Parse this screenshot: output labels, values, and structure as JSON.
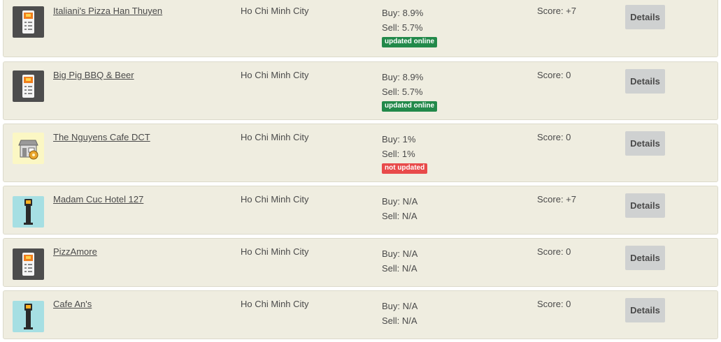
{
  "details_label": "Details",
  "colors": {
    "row_bg": "#efede0",
    "badge_online": "#22894a",
    "badge_offline": "#e84a4a",
    "button_bg": "#cfd1d1"
  },
  "listings": [
    {
      "name": "Italiani's Pizza Han Thuyen",
      "city": "Ho Chi Minh City",
      "buy": "Buy: 8.9%",
      "sell": "Sell: 5.7%",
      "badge": "updated online",
      "score": "Score: +7",
      "icon": "pos-terminal-icon"
    },
    {
      "name": "Big Pig BBQ & Beer",
      "city": "Ho Chi Minh City",
      "buy": "Buy: 8.9%",
      "sell": "Sell: 5.7%",
      "badge": "updated online",
      "score": "Score: 0",
      "icon": "pos-terminal-icon"
    },
    {
      "name": "The Nguyens Cafe DCT",
      "city": "Ho Chi Minh City",
      "buy": "Buy: 1%",
      "sell": "Sell: 1%",
      "badge": "not updated",
      "score": "Score: 0",
      "icon": "shop-icon"
    },
    {
      "name": "Madam Cuc Hotel 127",
      "city": "Ho Chi Minh City",
      "buy": "Buy: N/A",
      "sell": "Sell: N/A",
      "badge": "",
      "score": "Score: +7",
      "icon": "atm-kiosk-icon"
    },
    {
      "name": "PizzAmore",
      "city": "Ho Chi Minh City",
      "buy": "Buy: N/A",
      "sell": "Sell: N/A",
      "badge": "",
      "score": "Score: 0",
      "icon": "pos-terminal-icon"
    },
    {
      "name": "Cafe An's",
      "city": "Ho Chi Minh City",
      "buy": "Buy: N/A",
      "sell": "Sell: N/A",
      "badge": "",
      "score": "Score: 0",
      "icon": "atm-kiosk-icon"
    }
  ]
}
